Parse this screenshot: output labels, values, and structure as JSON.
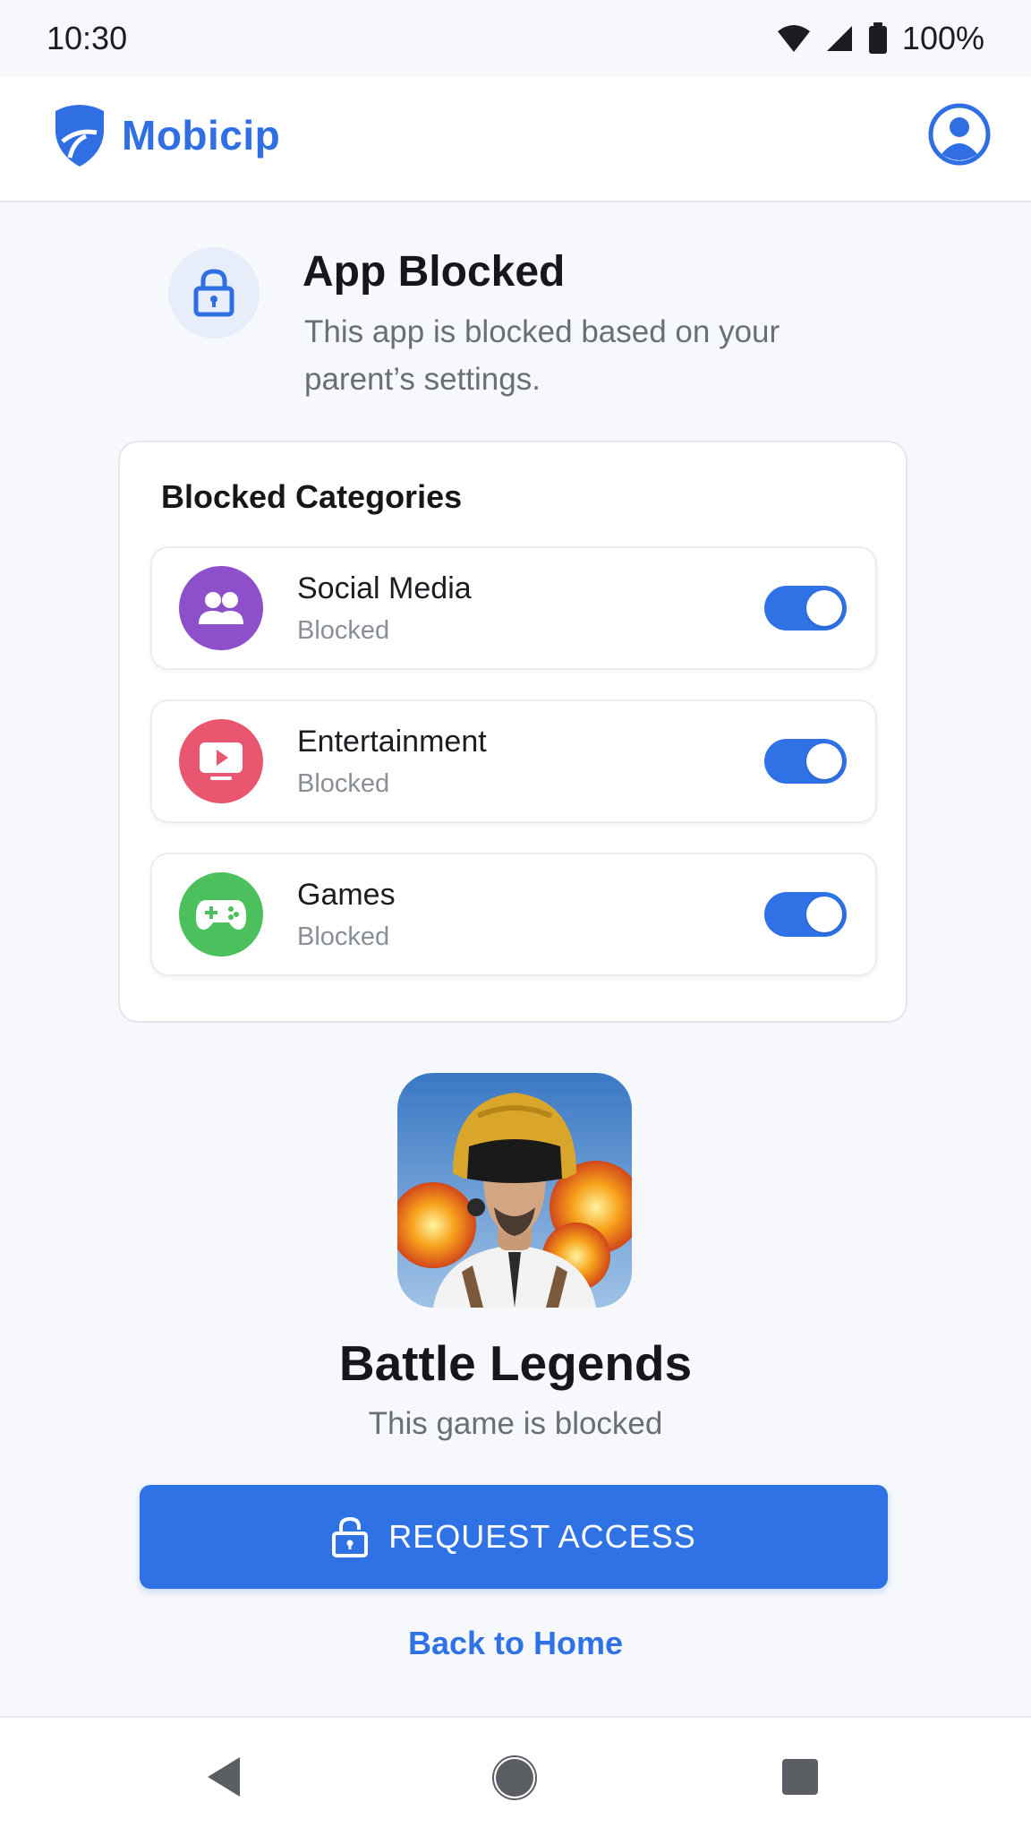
{
  "status_bar": {
    "time": "10:30",
    "battery": "100%"
  },
  "header": {
    "brand": "Mobicip"
  },
  "blocked": {
    "title": "App Blocked",
    "description": "This app is blocked based on your parent’s settings."
  },
  "categories": {
    "title": "Blocked Categories",
    "items": [
      {
        "name": "Social Media",
        "status": "Blocked",
        "icon": "people-icon",
        "color": "#8e4fcb",
        "enabled": true
      },
      {
        "name": "Entertainment",
        "status": "Blocked",
        "icon": "play-icon",
        "color": "#e8566f",
        "enabled": true
      },
      {
        "name": "Games",
        "status": "Blocked",
        "icon": "gamepad-icon",
        "color": "#4cc05d",
        "enabled": true
      }
    ]
  },
  "game": {
    "title": "Battle Legends",
    "subtitle": "This game is blocked"
  },
  "actions": {
    "request_label": "REQUEST ACCESS",
    "back_label": "Back to Home"
  },
  "colors": {
    "accent": "#2f72e6",
    "background": "#f6f8fb"
  }
}
